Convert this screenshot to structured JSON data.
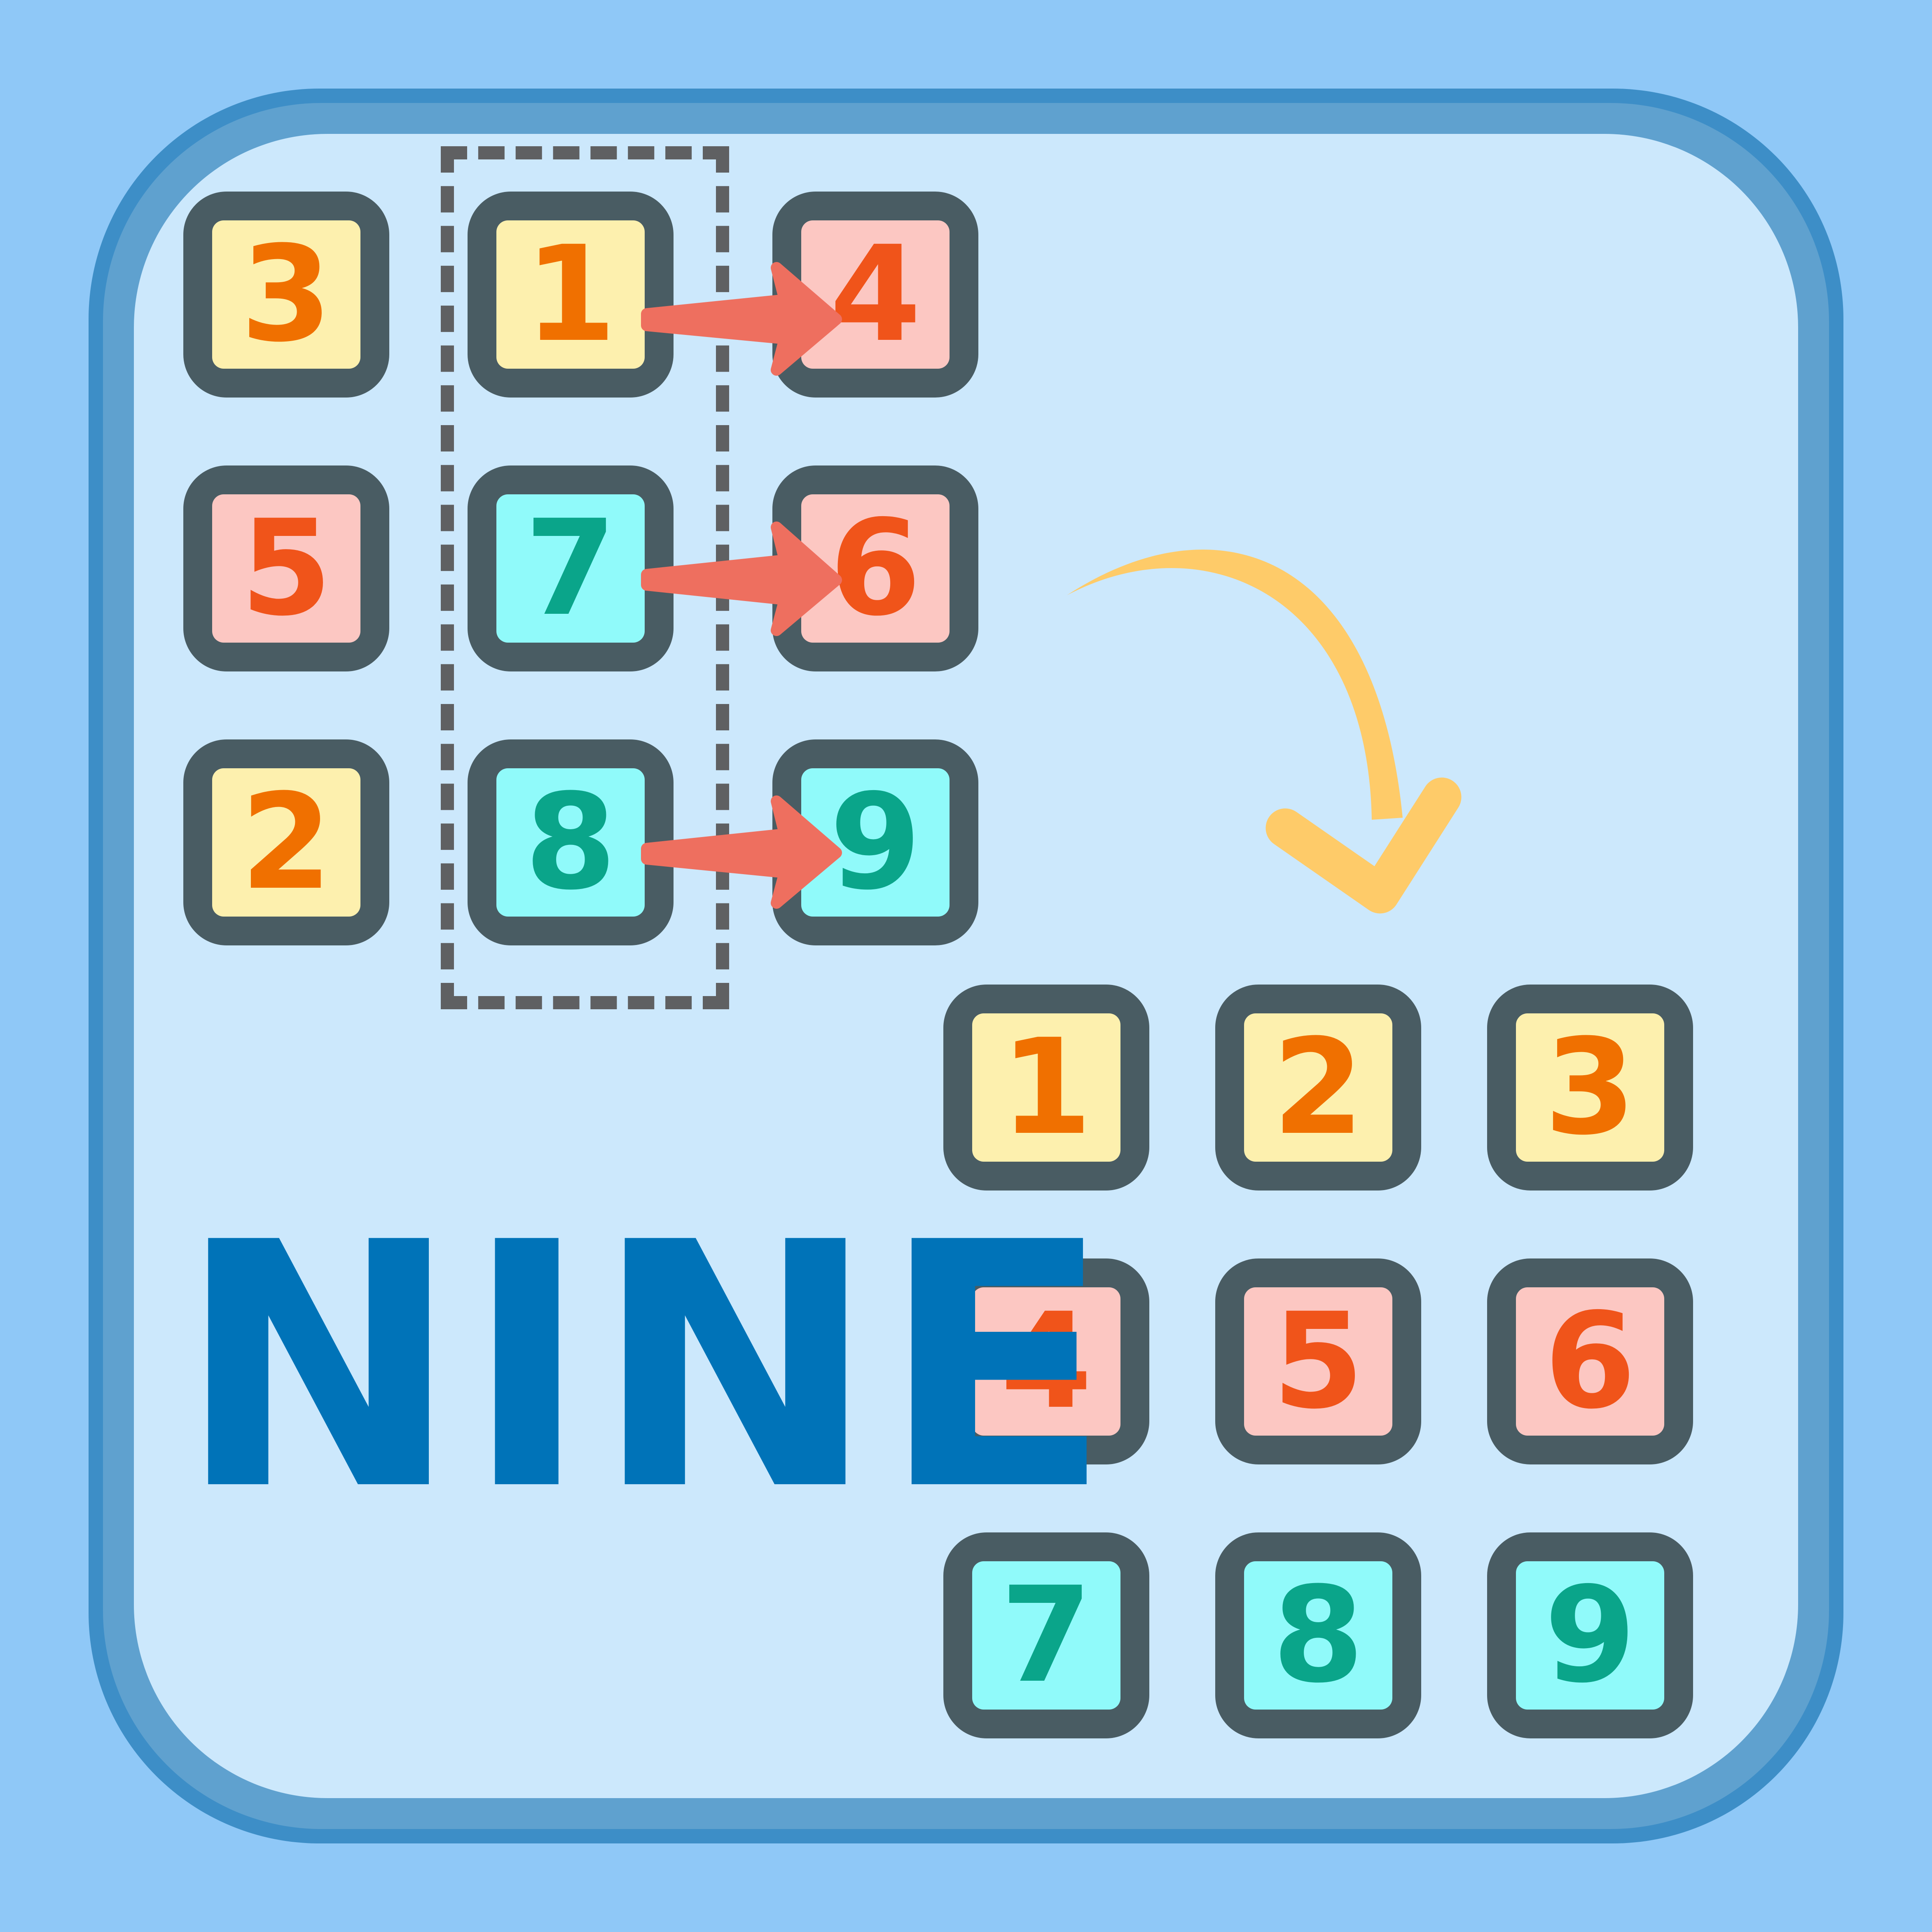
{
  "title": "NINE",
  "colors": {
    "background": "#8fc8f7",
    "panel": "#cce8fc",
    "tile_border": "#495c63",
    "yellow": "#fdf0ae",
    "pink": "#fcc7c2",
    "cyan": "#90fafa",
    "title": "#0073b8",
    "swap_arrow": "#ee6f5f",
    "result_arrow": "#fecb69"
  },
  "puzzle_grid": {
    "rows": [
      [
        {
          "n": "3",
          "color": "yellow"
        },
        {
          "n": "1",
          "color": "yellow"
        },
        {
          "n": "4",
          "color": "pink"
        }
      ],
      [
        {
          "n": "5",
          "color": "pink"
        },
        {
          "n": "7",
          "color": "cyan"
        },
        {
          "n": "6",
          "color": "pink"
        }
      ],
      [
        {
          "n": "2",
          "color": "yellow"
        },
        {
          "n": "8",
          "color": "cyan"
        },
        {
          "n": "9",
          "color": "cyan"
        }
      ]
    ]
  },
  "solved_grid": {
    "rows": [
      [
        {
          "n": "1",
          "color": "yellow"
        },
        {
          "n": "2",
          "color": "yellow"
        },
        {
          "n": "3",
          "color": "yellow"
        }
      ],
      [
        {
          "n": "4",
          "color": "pink"
        },
        {
          "n": "5",
          "color": "pink"
        },
        {
          "n": "6",
          "color": "pink"
        }
      ],
      [
        {
          "n": "7",
          "color": "cyan"
        },
        {
          "n": "8",
          "color": "cyan"
        },
        {
          "n": "9",
          "color": "cyan"
        }
      ]
    ]
  },
  "icons": {
    "swap": "right-arrow-icon",
    "result": "curved-arrow-icon"
  }
}
